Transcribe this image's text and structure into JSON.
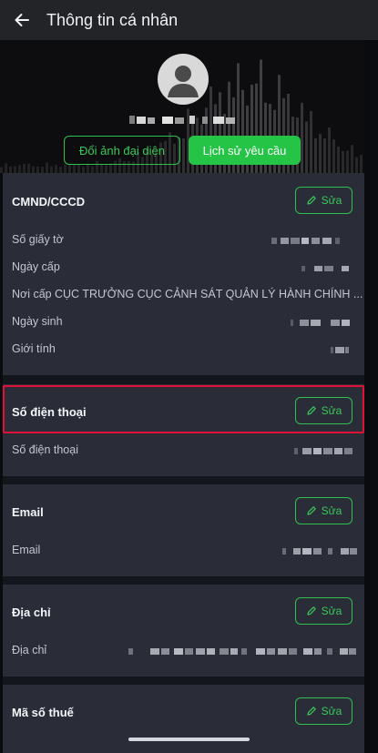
{
  "header": {
    "title": "Thông tin cá nhân"
  },
  "profile": {
    "change_avatar_label": "Đổi ảnh đại diện",
    "request_history_label": "Lịch sử yêu cầu"
  },
  "id_card": {
    "title": "CMND/CCCD",
    "edit_label": "Sửa",
    "rows": [
      {
        "label": "Số giấy tờ"
      },
      {
        "label": "Ngày cấp"
      },
      {
        "label": "Nơi cấp",
        "value": "CỤC TRƯỞNG CỤC CẢNH SÁT QUẢN LÝ HÀNH CHÍNH ..."
      },
      {
        "label": "Ngày sinh"
      },
      {
        "label": "Giới tính"
      }
    ]
  },
  "phone": {
    "title": "Số điện thoại",
    "edit_label": "Sửa",
    "row_label": "Số điện thoại"
  },
  "email": {
    "title": "Email",
    "edit_label": "Sửa",
    "row_label": "Email"
  },
  "address": {
    "title": "Địa chỉ",
    "edit_label": "Sửa",
    "row_label": "Địa chỉ"
  },
  "tax": {
    "title": "Mã số thuế",
    "edit_label": "Sửa"
  },
  "colors": {
    "accent": "#2fbf4f",
    "card": "#2a2d38",
    "background": "#14161d",
    "highlight": "#e1123a"
  }
}
